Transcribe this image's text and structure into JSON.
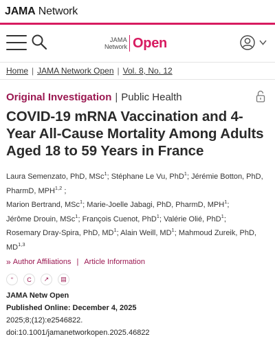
{
  "network": {
    "brand_bold": "JAMA",
    "brand_rest": " Network"
  },
  "colors": {
    "accent": "#d71b60",
    "section": "#9a1750"
  },
  "header": {
    "logo_line1": "JAMA",
    "logo_line2": "Network",
    "logo_open": "Open",
    "icons": [
      "menu-icon",
      "search-icon",
      "user-icon",
      "chevron-down-icon"
    ]
  },
  "breadcrumb": {
    "home": "Home",
    "journal": "JAMA Network Open",
    "volume": "Vol. 8, No. 12",
    "sep": "|"
  },
  "article": {
    "type": "Original Investigation",
    "type_sep": "|",
    "subject": "Public Health",
    "title": "COVID-19 mRNA Vaccination and 4-Year All-Cause Mortality Among Adults Aged 18 to 59 Years in France",
    "authors": [
      {
        "name": "Laura Semenzato, PhD, MSc",
        "sup": "1",
        "sep": ";"
      },
      {
        "name": "Stéphane Le Vu, PhD",
        "sup": "1",
        "sep": ";"
      },
      {
        "name": "Jérémie Botton, PhD, PharmD, MPH",
        "sup": "1,2",
        "sep": ";"
      },
      {
        "name": "Marion Bertrand, MSc",
        "sup": "1",
        "sep": ";"
      },
      {
        "name": "Marie-Joelle Jabagi, PhD, PharmD, MPH",
        "sup": "1",
        "sep": ";"
      },
      {
        "name": "Jérôme Drouin, MSc",
        "sup": "1",
        "sep": ";"
      },
      {
        "name": "François Cuenot, PhD",
        "sup": "1",
        "sep": ";"
      },
      {
        "name": "Valérie Olié, PhD",
        "sup": "1",
        "sep": ";"
      },
      {
        "name": "Rosemary Dray-Spira, PhD, MD",
        "sup": "1",
        "sep": ";"
      },
      {
        "name": "Alain Weill, MD",
        "sup": "1",
        "sep": ";"
      },
      {
        "name": "Mahmoud Zureik, PhD, MD",
        "sup": "1,3",
        "sep": ""
      }
    ],
    "affiliations_link": "Author Affiliations",
    "links_sep": "|",
    "article_info_link": "Article Information",
    "action_icons": [
      {
        "name": "cite-icon",
        "glyph": "“"
      },
      {
        "name": "copyright-icon",
        "glyph": "C"
      },
      {
        "name": "metrics-icon",
        "glyph": "↗"
      },
      {
        "name": "comment-icon",
        "glyph": "▤"
      }
    ],
    "journal": "JAMA Netw Open",
    "published": "Published Online: December 4, 2025",
    "citation": "2025;8;(12):e2546822.",
    "doi": "doi:10.1001/jamanetworkopen.2025.46822"
  }
}
